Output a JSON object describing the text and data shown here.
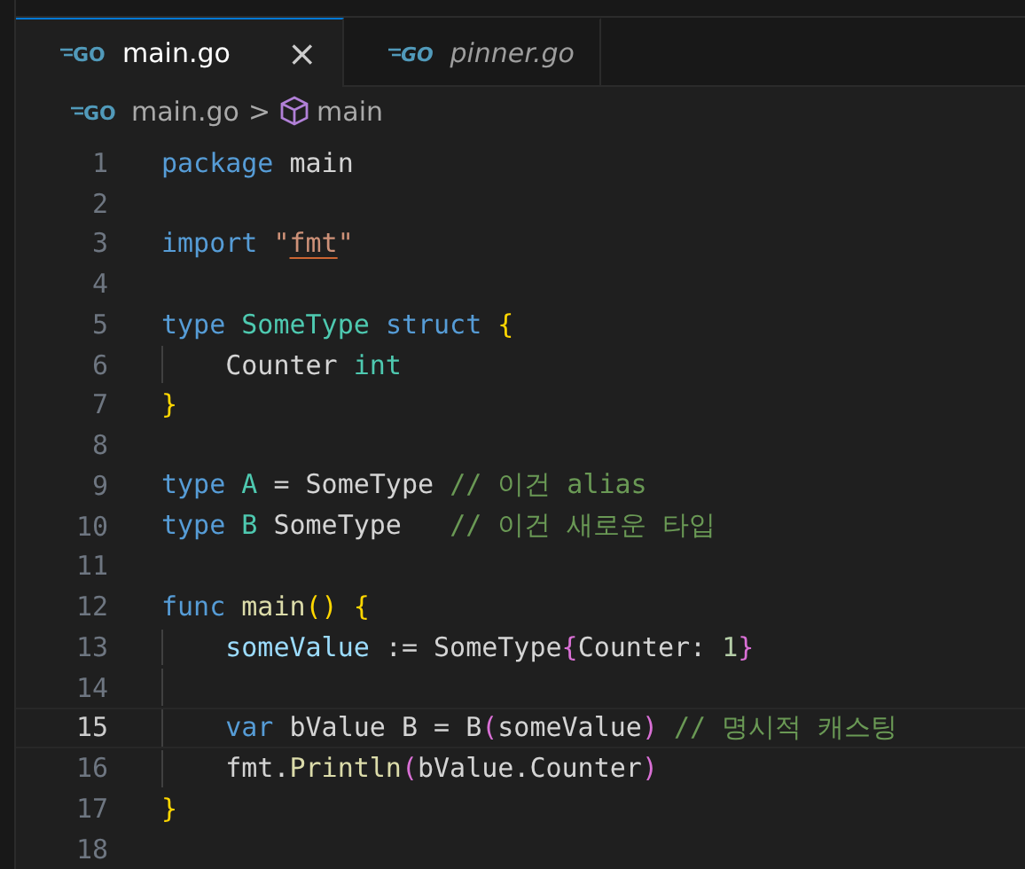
{
  "tabs": [
    {
      "icon_label": "GO",
      "label": "main.go",
      "selected": true,
      "preview": false,
      "close": "×"
    },
    {
      "icon_label": "GO",
      "label": "pinner.go",
      "selected": false,
      "preview": true
    }
  ],
  "breadcrumb": {
    "icon_label": "GO",
    "file": "main.go",
    "separator": ">",
    "symbol": "main"
  },
  "lines": [
    {
      "number": "1",
      "current": false,
      "tokens": [
        {
          "text": "package",
          "kind": "keyword"
        },
        {
          "text": " main",
          "kind": "plain"
        }
      ]
    },
    {
      "number": "2",
      "current": false
    },
    {
      "number": "3",
      "current": false,
      "tokens": [
        {
          "text": "import ",
          "kind": "keyword"
        },
        {
          "text": "\"",
          "kind": "string"
        },
        {
          "text": "fmt",
          "kind": "string",
          "warning": true
        },
        {
          "text": "\"",
          "kind": "string"
        }
      ]
    },
    {
      "number": "4",
      "current": false
    },
    {
      "number": "5",
      "current": false,
      "tokens": [
        {
          "text": "type ",
          "kind": "keyword"
        },
        {
          "text": "SomeType ",
          "kind": "type"
        },
        {
          "text": "struct ",
          "kind": "keyword"
        },
        {
          "text": "{",
          "kind": "bracket1"
        }
      ]
    },
    {
      "number": "6",
      "current": false,
      "guide": true,
      "tokens": [
        {
          "text": "    Counter ",
          "kind": "plain"
        },
        {
          "text": "int",
          "kind": "type"
        }
      ]
    },
    {
      "number": "7",
      "current": false,
      "tokens": [
        {
          "text": "}",
          "kind": "bracket1"
        }
      ]
    },
    {
      "number": "8",
      "current": false
    },
    {
      "number": "9",
      "current": false,
      "tokens": [
        {
          "text": "type ",
          "kind": "keyword"
        },
        {
          "text": "A",
          "kind": "type"
        },
        {
          "text": " = SomeType ",
          "kind": "plain"
        },
        {
          "text": "// 이건 alias",
          "kind": "comment"
        }
      ]
    },
    {
      "number": "10",
      "current": false,
      "tokens": [
        {
          "text": "type ",
          "kind": "keyword"
        },
        {
          "text": "B",
          "kind": "type"
        },
        {
          "text": " SomeType   ",
          "kind": "plain"
        },
        {
          "text": "// 이건 새로운 타입",
          "kind": "comment"
        }
      ]
    },
    {
      "number": "11",
      "current": false
    },
    {
      "number": "12",
      "current": false,
      "tokens": [
        {
          "text": "func ",
          "kind": "keyword"
        },
        {
          "text": "main",
          "kind": "function"
        },
        {
          "text": "() {",
          "kind": "bracket1"
        }
      ]
    },
    {
      "number": "13",
      "current": false,
      "guide": true,
      "tokens": [
        {
          "text": "    someValue",
          "kind": "variable"
        },
        {
          "text": " := SomeType",
          "kind": "plain"
        },
        {
          "text": "{",
          "kind": "bracket2"
        },
        {
          "text": "Counter: ",
          "kind": "plain"
        },
        {
          "text": "1",
          "kind": "number"
        },
        {
          "text": "}",
          "kind": "bracket2"
        }
      ]
    },
    {
      "number": "14",
      "current": false,
      "guide": true
    },
    {
      "number": "15",
      "current": true,
      "guide": true,
      "tokens": [
        {
          "text": "    var ",
          "kind": "keyword"
        },
        {
          "text": "bValue B = B",
          "kind": "plain"
        },
        {
          "text": "(",
          "kind": "bracket2"
        },
        {
          "text": "someValue",
          "kind": "plain"
        },
        {
          "text": ")",
          "kind": "bracket2"
        },
        {
          "text": " // 명시적 캐스팅",
          "kind": "comment"
        }
      ]
    },
    {
      "number": "16",
      "current": false,
      "guide": true,
      "tokens": [
        {
          "text": "    fmt.",
          "kind": "plain"
        },
        {
          "text": "Println",
          "kind": "function"
        },
        {
          "text": "(",
          "kind": "bracket2"
        },
        {
          "text": "bValue.Counter",
          "kind": "plain"
        },
        {
          "text": ")",
          "kind": "bracket2"
        }
      ]
    },
    {
      "number": "17",
      "current": false,
      "tokens": [
        {
          "text": "}",
          "kind": "bracket1"
        }
      ]
    },
    {
      "number": "18",
      "current": false
    }
  ]
}
